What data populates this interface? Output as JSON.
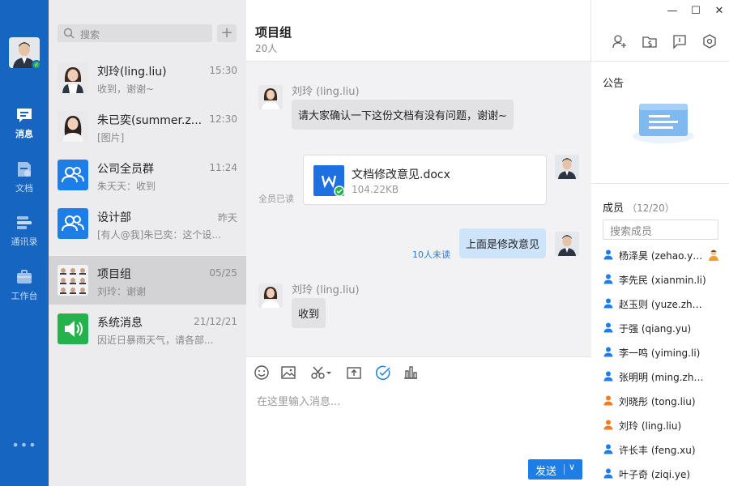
{
  "nav": {
    "items": [
      {
        "label": "消息",
        "icon": "chat-bubble-icon",
        "active": true
      },
      {
        "label": "文档",
        "icon": "document-icon",
        "active": false
      },
      {
        "label": "通讯录",
        "icon": "contacts-icon",
        "active": false
      },
      {
        "label": "工作台",
        "icon": "briefcase-icon",
        "active": false
      }
    ],
    "more": "•••"
  },
  "list": {
    "search_placeholder": "搜索",
    "add_label": "+",
    "conversations": [
      {
        "name": "刘玲(ling.liu)",
        "time": "15:30",
        "preview": "收到，谢谢~",
        "avatar": "person-photo"
      },
      {
        "name": "朱已奕(summer.z...",
        "time": "12:30",
        "preview": "[图片]",
        "avatar": "person-photo"
      },
      {
        "name": "公司全员群",
        "time": "11:24",
        "preview": "朱天天：收到",
        "avatar": "group-icon"
      },
      {
        "name": "设计部",
        "time": "昨天",
        "preview": "[有人@我]朱已奕：这个设...",
        "avatar": "group-icon"
      },
      {
        "name": "项目组",
        "time": "05/25",
        "preview": "刘玲：谢谢",
        "avatar": "group-photo-grid"
      },
      {
        "name": "系统消息",
        "time": "21/12/21",
        "preview": "因近日暴雨天气，请各部...",
        "avatar": "speaker-icon"
      }
    ]
  },
  "chat": {
    "title": "项目组",
    "member_count": "20人",
    "messages": [
      {
        "sender": "刘玲 (ling.liu)",
        "text": "请大家确认一下这份文档有没有问题，谢谢~"
      },
      {
        "file_name": "文档修改意见.docx",
        "file_size": "104.22KB",
        "read_status": "全员已读"
      },
      {
        "text": "上面是修改意见",
        "read_status": "10人未读"
      },
      {
        "sender": "刘玲 (ling.liu)",
        "text": "收到"
      }
    ],
    "input_placeholder": "在这里输入消息...",
    "send_label": "发送",
    "send_caret": "∨"
  },
  "right": {
    "announcement_title": "公告",
    "members_title": "成员",
    "members_count": "（12/20）",
    "member_search_placeholder": "搜索成员",
    "members": [
      {
        "name": "杨泽昊 (zehao.ya...",
        "color": "#1e7ee8",
        "admin": true
      },
      {
        "name": "李先民 (xianmin.li)",
        "color": "#1e7ee8"
      },
      {
        "name": "赵玉则 (yuze.zhao)",
        "color": "#1e7ee8"
      },
      {
        "name": "于强 (qiang.yu)",
        "color": "#1e7ee8"
      },
      {
        "name": "李一鸣 (yiming.li)",
        "color": "#1e7ee8"
      },
      {
        "name": "张明明 (ming.zha...",
        "color": "#1e7ee8"
      },
      {
        "name": "刘晓彤 (tong.liu)",
        "color": "#f07c26"
      },
      {
        "name": "刘玲 (ling.liu)",
        "color": "#f07c26"
      },
      {
        "name": "许长丰 (feng.xu)",
        "color": "#1e7ee8"
      },
      {
        "name": "叶子奇 (ziqi.ye)",
        "color": "#1e7ee8"
      }
    ]
  },
  "window": {
    "minimize": "—",
    "maximize": "☐",
    "close": "✕"
  },
  "colors": {
    "brand": "#1665c0",
    "accent": "#1e7ee8",
    "read_blue": "#1e7ee8",
    "online": "#2db34a"
  }
}
